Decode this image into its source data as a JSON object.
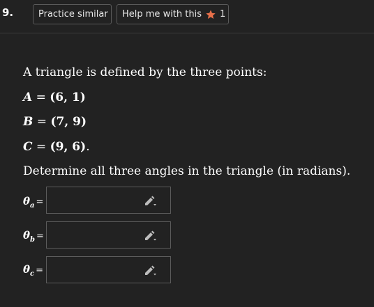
{
  "header": {
    "question_number": "9.",
    "practice_label": "Practice similar",
    "help_label": "Help me with this",
    "help_count": "1"
  },
  "problem": {
    "intro": "A triangle is defined by the three points:",
    "points": [
      {
        "name": "A",
        "equals": " = ",
        "coords": "(6, 1)",
        "trail": ""
      },
      {
        "name": "B",
        "equals": " = ",
        "coords": "(7, 9)",
        "trail": ""
      },
      {
        "name": "C",
        "equals": " = ",
        "coords": "(9, 6)",
        "trail": "."
      }
    ],
    "question": "Determine all three angles in the triangle (in radians)."
  },
  "answers": [
    {
      "symbol": "θ",
      "sub": "a",
      "equals": "=",
      "value": ""
    },
    {
      "symbol": "θ",
      "sub": "b",
      "equals": "=",
      "value": ""
    },
    {
      "symbol": "θ",
      "sub": "c",
      "equals": "=",
      "value": ""
    }
  ],
  "colors": {
    "background": "#222222",
    "text": "#ffffff",
    "button_border": "#5a5a5a",
    "star": "#e8704a",
    "divider": "#3c3c3c",
    "input_border": "#5c5c5c",
    "pencil": "#bdbdbd"
  },
  "icons": {
    "star": "star-icon",
    "pencil": "pencil-icon"
  }
}
